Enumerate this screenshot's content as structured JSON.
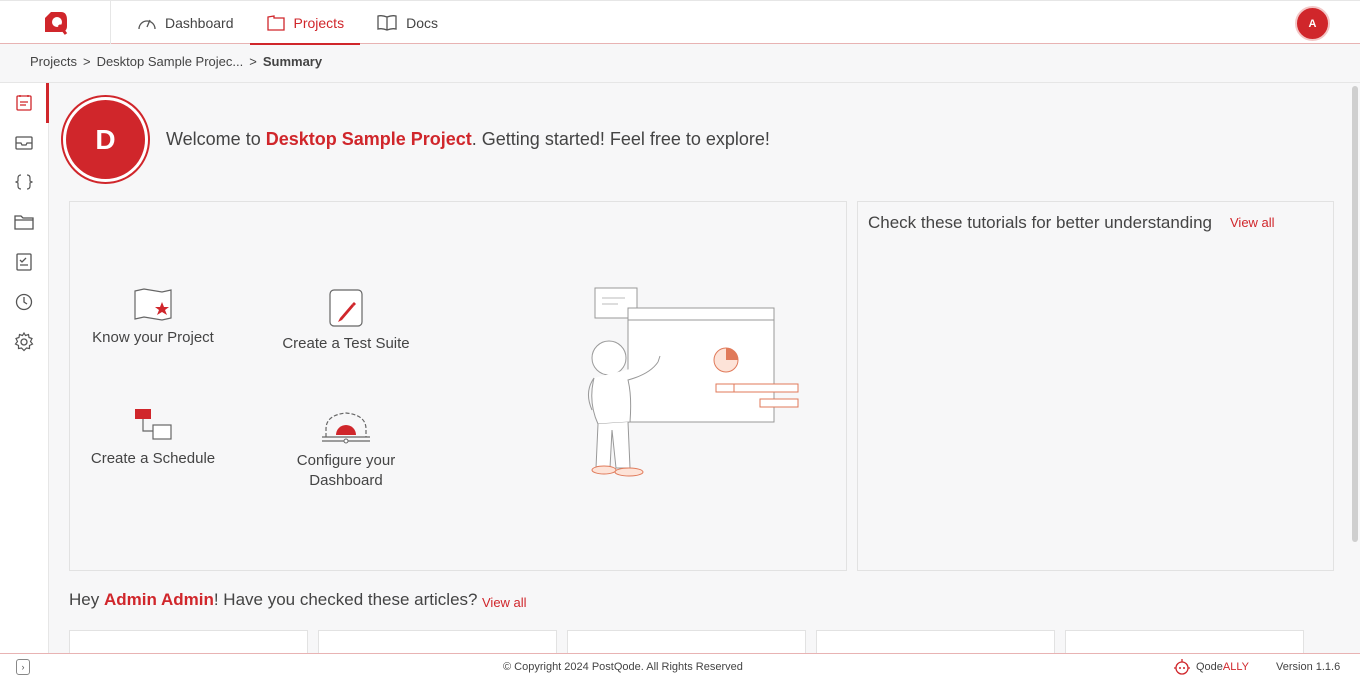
{
  "colors": {
    "accent": "#d0262b",
    "background": "#f7f7f8"
  },
  "nav": {
    "items": [
      {
        "label": "Dashboard",
        "icon": "gauge-icon"
      },
      {
        "label": "Projects",
        "icon": "folder-icon"
      },
      {
        "label": "Docs",
        "icon": "book-icon"
      }
    ],
    "user_initial": "A"
  },
  "breadcrumb": {
    "root": "Projects",
    "sep": ">",
    "project": "Desktop Sample Projec...",
    "current": "Summary"
  },
  "welcome": {
    "initial": "D",
    "prefix": "Welcome to ",
    "project": "Desktop Sample Project",
    "suffix": ". Getting started! Feel free to explore!"
  },
  "tiles": {
    "know": "Know your Project",
    "suite": "Create a Test Suite",
    "schedule": "Create a Schedule",
    "configure": "Configure your Dashboard"
  },
  "tutorials": {
    "title": "Check these tutorials for better understanding",
    "view_all": "View all"
  },
  "articles": {
    "prefix": "Hey ",
    "name": "Admin Admin",
    "suffix": "! Have you checked these articles?",
    "view_all": "View all"
  },
  "footer": {
    "copyright": "© Copyright 2024 PostQode. All Rights Reserved",
    "brand_a": "Qode",
    "brand_b": "ALLY",
    "version": "Version 1.1.6"
  }
}
